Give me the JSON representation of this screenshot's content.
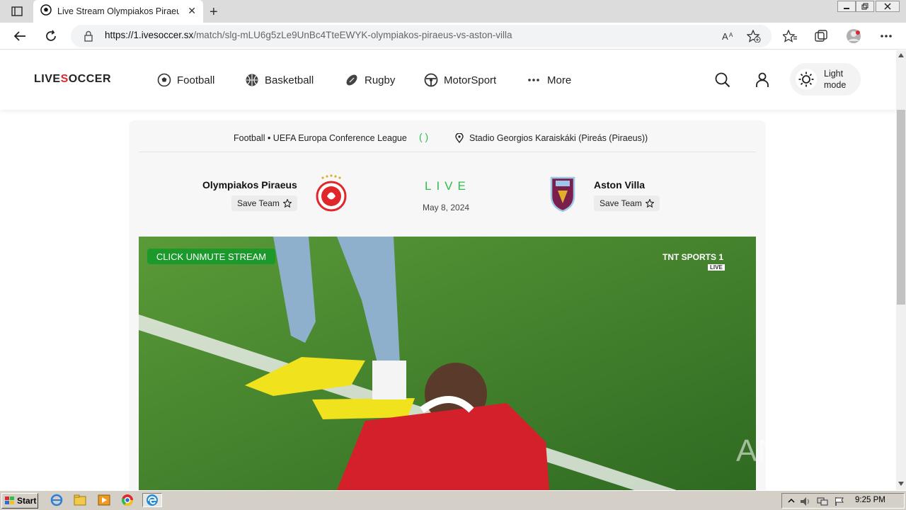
{
  "browser": {
    "tab_title": "Live Stream Olympiakos Piraeus vs Aston Villa",
    "tab_close": "✕",
    "new_tab": "+",
    "url_host": "https://1.ivesoccer.sx",
    "url_path": "/match/slg-mLU6g5zLe9UnBc4TteEWYK-olympiakos-piraeus-vs-aston-villa"
  },
  "site": {
    "logo_pre": "LIVE",
    "logo_mid": "S",
    "logo_post": "OCCER",
    "nav": [
      {
        "label": "Football"
      },
      {
        "label": "Basketball"
      },
      {
        "label": "Rugby"
      },
      {
        "label": "MotorSport"
      },
      {
        "label": "More"
      }
    ],
    "mode_label": "Light mode"
  },
  "match": {
    "competition": "Football • UEFA Europa Conference League",
    "score_placeholder": "( )",
    "venue": "Stadio Georgios Karaiskáki (Pireás (Piraeus))",
    "home_team": "Olympiakos Piraeus",
    "away_team": "Aston Villa",
    "save_team_label": "Save Team",
    "status": "LIVE",
    "date": "May 8, 2024",
    "home_badge_color": "#e0272b",
    "away_badge_color": "#7a1e4c"
  },
  "player": {
    "unmute_label": "CLICK UNMUTE STREAM",
    "channel_line1": "TNT SPORTS 1",
    "channel_line2": "LIVE"
  },
  "watermark": "ANY RUN",
  "taskbar": {
    "start_label": "Start",
    "clock": "9:25 PM"
  }
}
